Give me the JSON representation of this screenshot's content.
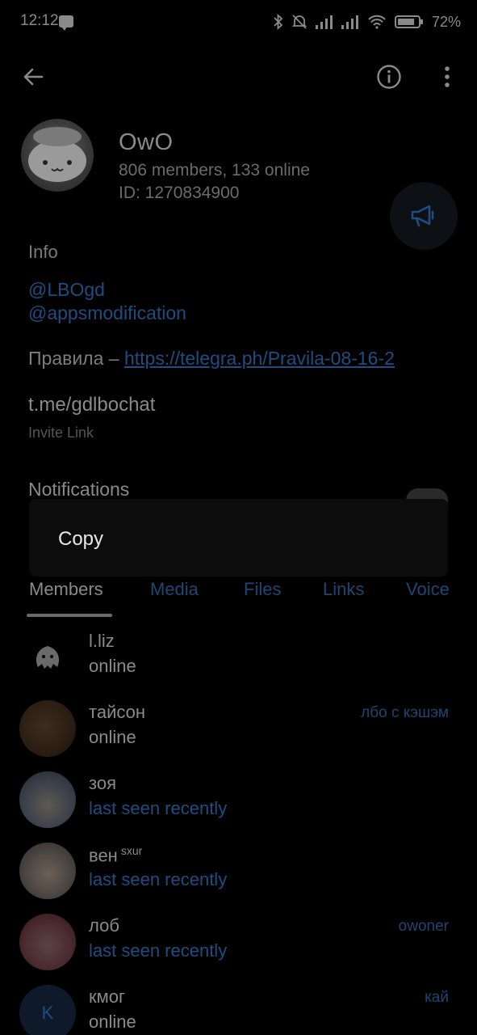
{
  "status_bar": {
    "time": "12:12",
    "battery": "72%"
  },
  "chat": {
    "title": "OwO",
    "members_line": "806 members, 133 online",
    "id_line": "ID: 1270834900"
  },
  "info": {
    "label": "Info",
    "link1": "@LBOgd",
    "link2": "@appsmodification",
    "rules_prefix": "Правила – ",
    "rules_link": "https://telegra.ph/Pravila-08-16-2",
    "invite_link": "t.me/gdlbochat",
    "invite_label": "Invite Link"
  },
  "notifications": {
    "label": "Notifications"
  },
  "popup": {
    "copy_label": "Copy"
  },
  "tabs": [
    "Members",
    "Media",
    "Files",
    "Links",
    "Voice"
  ],
  "members": [
    {
      "name": "l.liz",
      "status": "online",
      "role": "",
      "tag": ""
    },
    {
      "name": "тайсон",
      "status": "online",
      "role": "лбо с кэшэм",
      "tag": ""
    },
    {
      "name": "зоя",
      "status": "last seen recently",
      "role": "",
      "tag": ""
    },
    {
      "name": "вен",
      "status": "last seen recently",
      "role": "",
      "tag": "sxur"
    },
    {
      "name": "лоб",
      "status": "last seen recently",
      "role": "owoner",
      "tag": ""
    },
    {
      "name": "кмог",
      "status": "online",
      "role": "кай",
      "tag": "",
      "initial": "K"
    }
  ],
  "colors": {
    "background": "#000000",
    "link": "#1f4d80",
    "popup": "#0c0c0c"
  }
}
